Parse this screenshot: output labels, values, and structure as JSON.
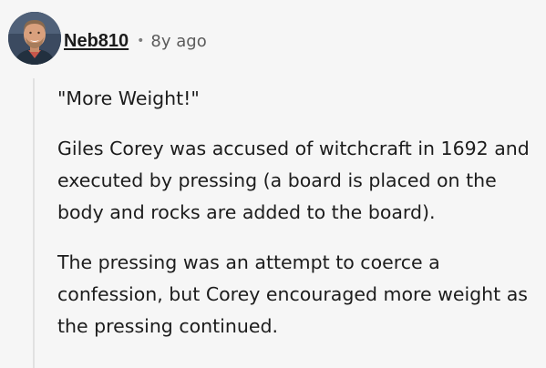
{
  "comment": {
    "author": "Neb810",
    "separator": "•",
    "timestamp": "8y ago",
    "paragraphs": [
      "\"More Weight!\"",
      "Giles Corey was accused of witchcraft in 1692 and executed by pressing (a board is placed on the body and rocks are added to the board).",
      "The pressing was an attempt to coerce a confession, but Corey encouraged more weight as the pressing continued."
    ]
  },
  "colors": {
    "background": "#f6f6f6",
    "text": "#1c1c1c",
    "muted": "#5b5b5b",
    "thread_line": "#e1e1e1"
  },
  "icons": {
    "avatar": "user-avatar-photo"
  }
}
